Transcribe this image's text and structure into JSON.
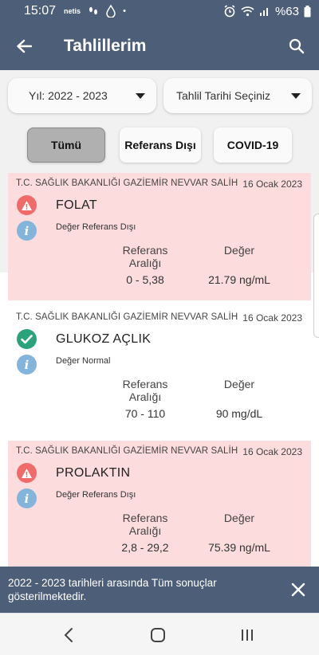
{
  "status_bar": {
    "time": "15:07",
    "notifications": [
      "netlify-icon",
      "footsteps-icon",
      "drop-icon",
      "dot"
    ],
    "battery": "%63"
  },
  "app_bar": {
    "title": "Tahlillerim"
  },
  "filters": {
    "year_select": "Yıl: 2022 - 2023",
    "date_select": "Tahlil Tarihi Seçiniz",
    "tabs": [
      {
        "label": "Tümü",
        "active": true
      },
      {
        "label": "Referans Dışı",
        "active": false
      },
      {
        "label": "COVID-19",
        "active": false
      }
    ]
  },
  "columns": {
    "reference": "Referans Aralığı",
    "value": "Değer"
  },
  "results": [
    {
      "lab": "T.C. SAĞLIK BAKANLIĞI GAZİEMİR NEVVAR SALİH",
      "date": "16 Ocak 2023",
      "name": "FOLAT",
      "status": "Değer Referans Dışı",
      "status_icon": "warning-icon",
      "reference": "0 - 5,38",
      "value": "21.79 ng/mL"
    },
    {
      "lab": "T.C. SAĞLIK BAKANLIĞI GAZİEMİR NEVVAR SALİH",
      "date": "16 Ocak 2023",
      "name": "GLUKOZ AÇLIK",
      "status": "Değer Normal",
      "status_icon": "check-icon",
      "reference": "70 - 110",
      "value": "90 mg/dL"
    },
    {
      "lab": "T.C. SAĞLIK BAKANLIĞI GAZİEMİR NEVVAR SALİH",
      "date": "16 Ocak 2023",
      "name": "PROLAKTIN",
      "status": "Değer Referans Dışı",
      "status_icon": "warning-icon",
      "reference": "2,8 - 29,2",
      "value": "75.39 ng/mL"
    }
  ],
  "snackbar": {
    "message": "2022 - 2023 tarihleri arasında Tüm sonuçlar gösterilmektedir."
  },
  "colors": {
    "primary": "#4d5f78",
    "abnormal_bg": "#fcdcdc",
    "warning": "#f06a6a",
    "ok": "#2aa37a",
    "info": "#82b4dc"
  }
}
